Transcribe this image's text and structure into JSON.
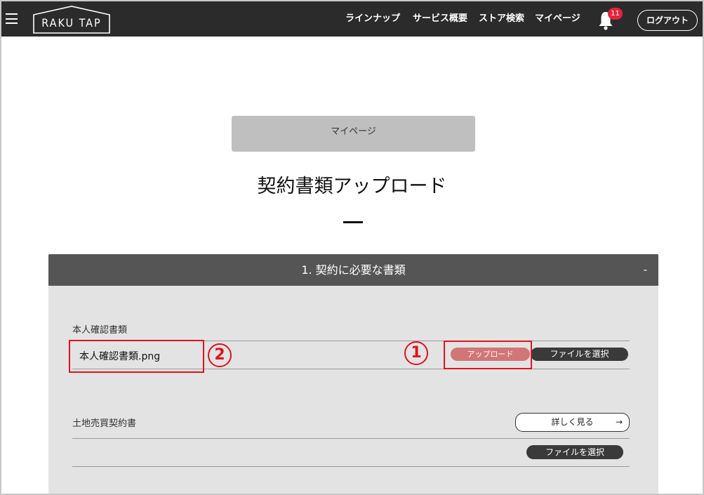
{
  "header": {
    "logo": "RAKU TAP",
    "nav": [
      "ラインナップ",
      "サービス概要",
      "ストア検索",
      "マイページ"
    ],
    "notification_count": "11",
    "logout_label": "ログアウト"
  },
  "main": {
    "mypage_button": "マイページ",
    "title": "契約書類アップロード",
    "panel": {
      "title": "1. 契約に必要な書類",
      "toggle": "-",
      "sections": [
        {
          "label": "本人確認書類",
          "file_name": "本人確認書類.png",
          "upload_label": "アップロード",
          "select_label": "ファイルを選択"
        },
        {
          "label": "土地売買契約書",
          "detail_label": "詳しく見る",
          "detail_arrow": "→",
          "select_label": "ファイルを選択"
        }
      ]
    }
  },
  "annotations": {
    "marker_1": "1",
    "marker_2": "2",
    "color": "#e0121f"
  },
  "colors": {
    "header_bg": "#2b2b2b",
    "panel_head": "#555555",
    "panel_bg": "#e3e3e3",
    "badge": "#e5233d",
    "upload_button": "#d27577"
  }
}
